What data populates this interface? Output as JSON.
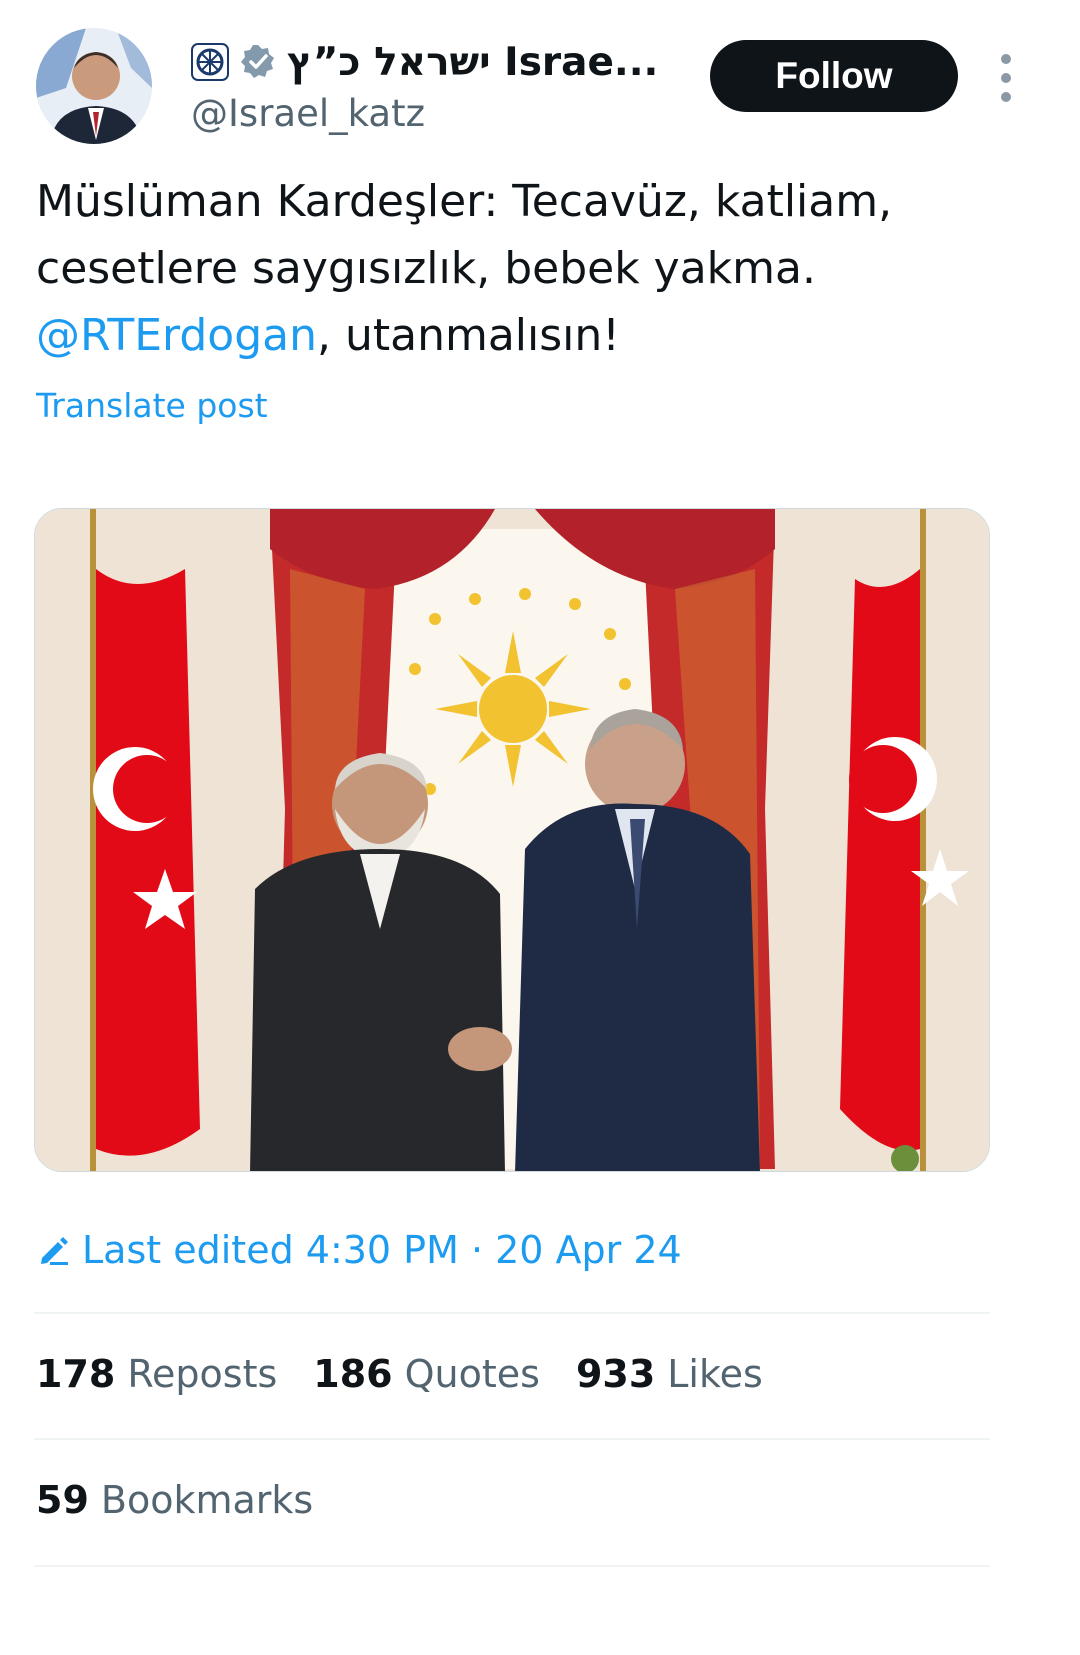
{
  "author": {
    "display_name": "ישראל כ”ץ Israe...",
    "handle": "@Israel_katz",
    "verified": true
  },
  "actions": {
    "follow_label": "Follow"
  },
  "tweet": {
    "line1": "Müslüman Kardeşler: Tecavüz, katliam,",
    "line2": "cesetlere saygısızlık, bebek yakma.",
    "mention": "@RTErdogan",
    "line3_rest": ", utanmalısın!",
    "translate_label": "Translate post"
  },
  "media": {
    "icon": "photo"
  },
  "edit_info": {
    "text": "Last edited 4:30 PM · 20 Apr 24"
  },
  "stats": {
    "reposts_count": "178",
    "reposts_label": "Reposts",
    "quotes_count": "186",
    "quotes_label": "Quotes",
    "likes_count": "933",
    "likes_label": "Likes",
    "bookmarks_count": "59",
    "bookmarks_label": "Bookmarks"
  },
  "colors": {
    "link": "#1d9bf0",
    "text": "#0f1419",
    "secondary": "#536471",
    "button_bg": "#0f1419",
    "flag_red": "#e30a17"
  }
}
